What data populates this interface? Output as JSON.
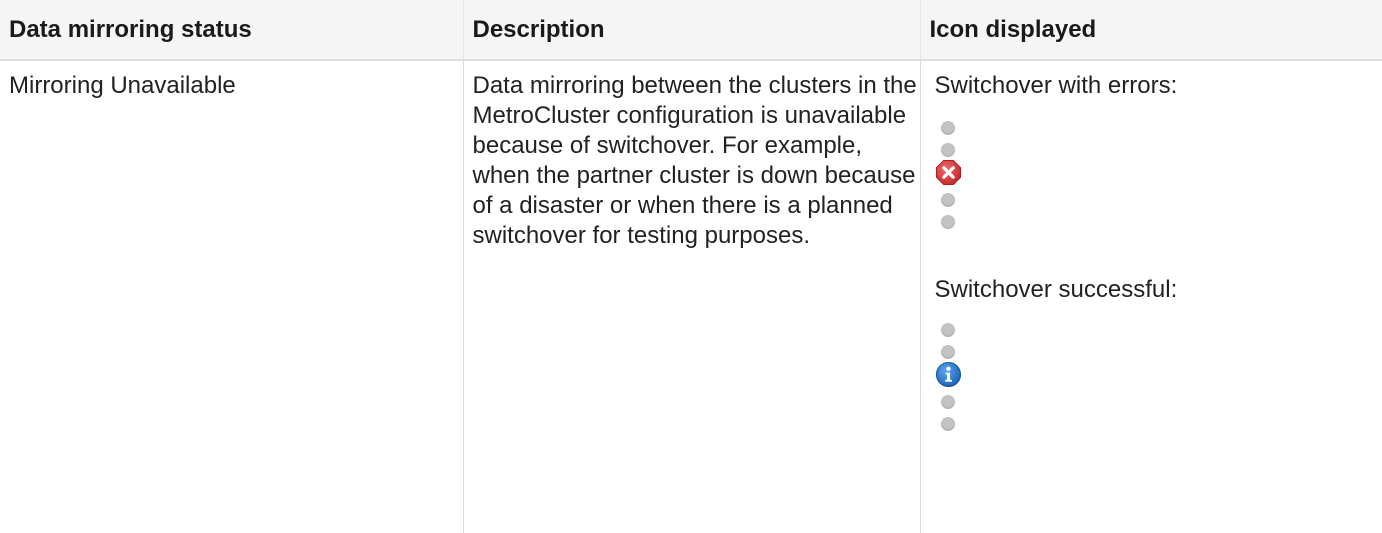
{
  "table": {
    "headers": {
      "status": "Data mirroring status",
      "description": "Description",
      "icon": "Icon displayed"
    },
    "rows": [
      {
        "status": "Mirroring Unavailable",
        "description": "Data mirroring between the clusters in the MetroCluster configuration is unavailable because of switchover. For example, when the partner cluster is down because of a disaster or when there is a planned switchover for testing purposes.",
        "icon_groups": [
          {
            "label": "Switchover with errors:",
            "icon": "error-x-icon",
            "color": "#d9383a"
          },
          {
            "label": "Switchover successful:",
            "icon": "info-icon",
            "color": "#1f73c7"
          }
        ]
      }
    ]
  },
  "colors": {
    "header_bg": "#f5f5f5",
    "dot": "#c3c3c3",
    "error": "#d9383a",
    "info": "#1f73c7"
  }
}
